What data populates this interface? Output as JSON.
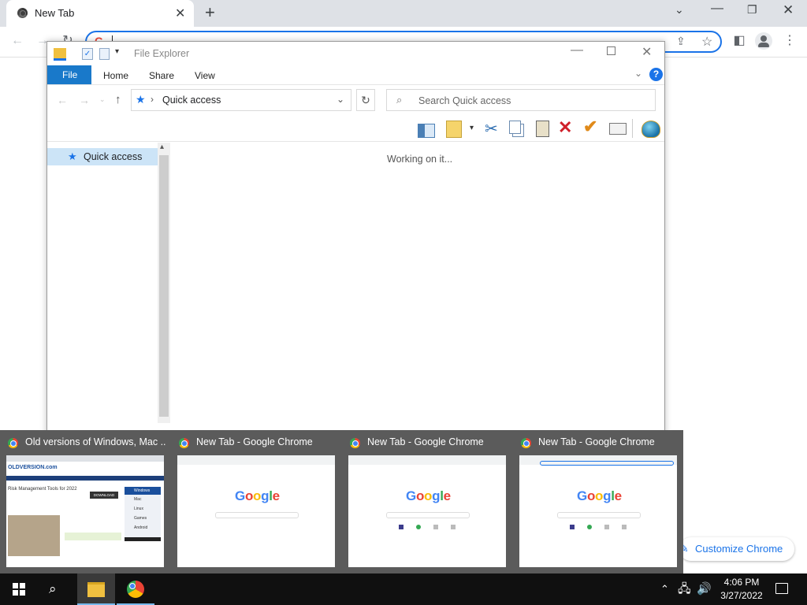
{
  "chrome": {
    "tab_title": "New Tab",
    "omnibox_value": "",
    "customize_label": "Customize Chrome"
  },
  "explorer": {
    "title": "File Explorer",
    "ribbon_tabs": [
      "File",
      "Home",
      "Share",
      "View"
    ],
    "address": "Quick access",
    "search_placeholder": "Search Quick access",
    "nav_item": "Quick access",
    "status_text": "Working on it..."
  },
  "previews": [
    {
      "title": "Old versions of Windows, Mac ..."
    },
    {
      "title": "New Tab - Google Chrome"
    },
    {
      "title": "New Tab - Google Chrome"
    },
    {
      "title": "New Tab - Google Chrome"
    }
  ],
  "thumb_oldversion": {
    "site_name": "OLDVERSION.com",
    "headline": "Risk Management Tools for 2022",
    "download_label": "DOWNLOAD",
    "menu": [
      "Windows",
      "Mac",
      "Linux",
      "Games",
      "Android"
    ]
  },
  "thumb_google": {
    "logo": "Google"
  },
  "taskbar": {
    "time": "4:06 PM",
    "date": "3/27/2022"
  },
  "colors": {
    "accent": "#1a73e8",
    "file_tab": "#1979ca",
    "taskbar": "#101010"
  }
}
